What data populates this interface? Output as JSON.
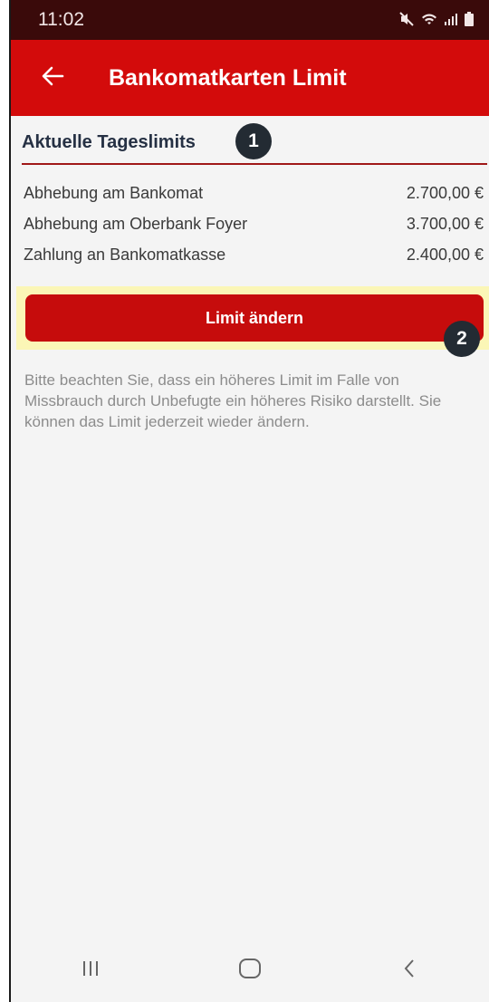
{
  "status_bar": {
    "time": "11:02",
    "icons": [
      "mute-icon",
      "wifi-icon",
      "signal-icon",
      "battery-icon"
    ]
  },
  "app_bar": {
    "title": "Bankomatkarten Limit",
    "back_icon": "arrow-left-icon"
  },
  "section": {
    "title": "Aktuelle Tageslimits"
  },
  "badges": [
    "1",
    "2"
  ],
  "limits": [
    {
      "label": "Abhebung am Bankomat",
      "value": "2.700,00 €"
    },
    {
      "label": "Abhebung am Oberbank Foyer",
      "value": "3.700,00 €"
    },
    {
      "label": "Zahlung an Bankomatkasse",
      "value": "2.400,00 €"
    }
  ],
  "action": {
    "button_label": "Limit ändern"
  },
  "notice": "Bitte beachten Sie, dass ein höheres Limit im Falle von Missbrauch durch Unbefugte ein höheres Risiko darstellt. Sie können das Limit jederzeit wieder ändern.",
  "colors": {
    "brand_red": "#d30b0b",
    "status_bar": "#3a0a0a",
    "badge": "#232b33",
    "highlight": "#fbf6b6"
  }
}
